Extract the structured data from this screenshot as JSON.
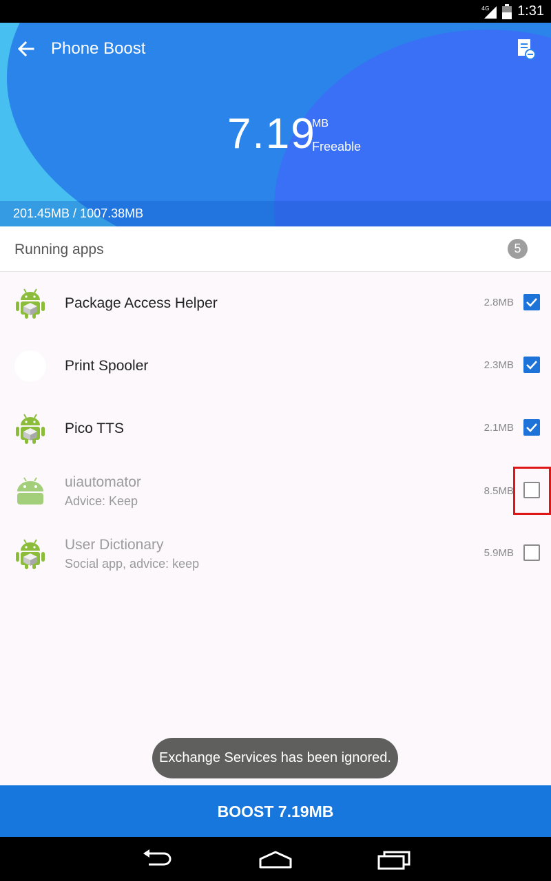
{
  "status_bar": {
    "network": "4G",
    "time": "1:31"
  },
  "header": {
    "title": "Phone Boost",
    "freeable_value": "7.19",
    "freeable_unit": "MB",
    "freeable_label": "Freeable",
    "memory_usage": "201.45MB / 1007.38MB"
  },
  "list": {
    "header_label": "Running apps",
    "count": "5",
    "apps": [
      {
        "name": "Package Access Helper",
        "subtitle": "",
        "size": "2.8MB",
        "checked": true,
        "icon": "android-package-icon"
      },
      {
        "name": "Print Spooler",
        "subtitle": "",
        "size": "2.3MB",
        "checked": true,
        "icon": "print-spooler-icon"
      },
      {
        "name": "Pico TTS",
        "subtitle": "",
        "size": "2.1MB",
        "checked": true,
        "icon": "android-package-icon"
      },
      {
        "name": "uiautomator",
        "subtitle": "Advice: Keep",
        "size": "8.5MB",
        "checked": false,
        "icon": "android-icon"
      },
      {
        "name": "User Dictionary",
        "subtitle": "Social app, advice: keep",
        "size": "5.9MB",
        "checked": false,
        "icon": "android-package-icon"
      }
    ]
  },
  "toast": "Exchange Services has been ignored.",
  "boost_button": "BOOST 7.19MB",
  "colors": {
    "accent": "#1877dc",
    "hero_light": "#47bff0",
    "hero_dark": "#2a84ea",
    "highlight": "#e01616"
  }
}
